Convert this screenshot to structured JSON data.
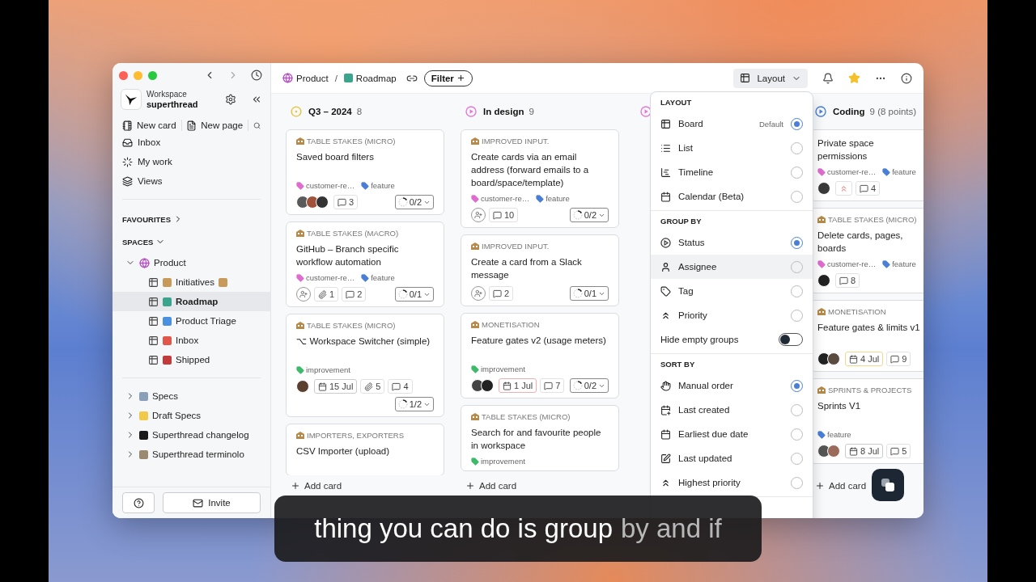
{
  "sidebar": {
    "workspace": {
      "caption": "Workspace",
      "name": "superthread"
    },
    "actions": [
      {
        "label": "New card"
      },
      {
        "label": "New page"
      }
    ],
    "nav": [
      {
        "label": "Inbox"
      },
      {
        "label": "My work"
      },
      {
        "label": "Views"
      }
    ],
    "favourites": {
      "label": "FAVOURITES",
      "expanded": false
    },
    "spaces": {
      "label": "SPACES",
      "expanded": true
    },
    "tree": [
      {
        "kind": "space",
        "label": "Product",
        "color": "#b44fc4",
        "expanded": true,
        "selected": false,
        "children": [
          {
            "kind": "board",
            "label": "Initiatives",
            "color": "#c89a5a",
            "icon_after": true,
            "selected": false
          },
          {
            "kind": "board",
            "label": "Roadmap",
            "color": "#3aa58c",
            "selected": true
          },
          {
            "kind": "board",
            "label": "Product Triage",
            "color": "#4a8fe0",
            "selected": false
          },
          {
            "kind": "board",
            "label": "Inbox",
            "color": "#e0564a",
            "selected": false
          },
          {
            "kind": "board",
            "label": "Shipped",
            "color": "#c23a3a",
            "selected": false
          }
        ]
      },
      {
        "kind": "page",
        "label": "Specs",
        "color": "#8aa0b8",
        "expanded": false,
        "selected": false
      },
      {
        "kind": "page",
        "label": "Draft Specs",
        "color": "#f0c94a",
        "expanded": false,
        "selected": false
      },
      {
        "kind": "page",
        "label": "Superthread changelog",
        "color": "#1a1a1a",
        "expanded": false,
        "selected": false
      },
      {
        "kind": "page",
        "label": "Superthread terminolo",
        "color": "#9a8a70",
        "expanded": false,
        "selected": false
      }
    ],
    "invite": "Invite"
  },
  "topbar": {
    "breadcrumb": [
      {
        "label": "Product",
        "color": "#b44fc4"
      },
      {
        "label": "Roadmap",
        "color": "#3aa58c"
      }
    ],
    "separator": "/",
    "filter": "Filter",
    "layout": "Layout",
    "starred": true
  },
  "columns": [
    {
      "kind": "planned",
      "title": "Q3 – 2024",
      "count": "8",
      "color": "#e8c33a",
      "add": "Add card",
      "cards": [
        {
          "label": "TABLE STAKES (MICRO)",
          "title": "Saved board filters",
          "tags": [
            {
              "label": "customer-re…",
              "color": "#e06ccf"
            },
            {
              "label": "feature",
              "color": "#4a7fd8"
            }
          ],
          "avatars": [
            {
              "color": "#5a5a5a"
            },
            {
              "color": "#a0523a"
            },
            {
              "color": "#333333"
            }
          ],
          "chips": [
            {
              "kind": "comment",
              "text": "3"
            }
          ],
          "progress": {
            "text": "0/2"
          }
        },
        {
          "label": "TABLE STAKES (MACRO)",
          "title": "GitHub – Branch specific workflow automation",
          "tags": [
            {
              "label": "customer-re…",
              "color": "#e06ccf"
            },
            {
              "label": "feature",
              "color": "#4a7fd8"
            }
          ],
          "assign": true,
          "chips": [
            {
              "kind": "attachment",
              "text": "1"
            },
            {
              "kind": "comment",
              "text": "2"
            }
          ],
          "progress": {
            "text": "0/1"
          }
        },
        {
          "label": "TABLE STAKES (MICRO)",
          "title": "⌥ Workspace Switcher (simple)",
          "tags": [
            {
              "label": "improvement",
              "color": "#3dbb6a"
            }
          ],
          "avatars": [
            {
              "color": "#5b4030"
            }
          ],
          "chips": [
            {
              "kind": "date",
              "text": "15 Jul",
              "color": "#c8ccd1"
            },
            {
              "kind": "attachment",
              "text": "5"
            },
            {
              "kind": "comment",
              "text": "4"
            }
          ],
          "progress": {
            "text": "1/2"
          }
        },
        {
          "label": "IMPORTERS, EXPORTERS",
          "title": "CSV Importer (upload)"
        }
      ]
    },
    {
      "kind": "started",
      "title": "In design",
      "count": "9",
      "color": "#e27ad8",
      "add": "Add card",
      "cards": [
        {
          "label": "IMPROVED INPUT.",
          "title": "Create cards via an email address (forward emails to a board/space/template)",
          "tags": [
            {
              "label": "customer-re…",
              "color": "#e06ccf"
            },
            {
              "label": "feature",
              "color": "#4a7fd8"
            }
          ],
          "assign": true,
          "chips": [
            {
              "kind": "comment",
              "text": "10"
            }
          ],
          "progress": {
            "text": "0/2"
          }
        },
        {
          "label": "IMPROVED INPUT.",
          "title": "Create a card from a Slack message",
          "assign": true,
          "chips": [
            {
              "kind": "comment",
              "text": "2"
            }
          ],
          "progress": {
            "text": "0/1"
          }
        },
        {
          "label": "MONETISATION",
          "title": "Feature gates v2 (usage meters)",
          "tags": [
            {
              "label": "improvement",
              "color": "#3dbb6a"
            }
          ],
          "avatars": [
            {
              "color": "#444444"
            },
            {
              "color": "#222222"
            }
          ],
          "chips": [
            {
              "kind": "date",
              "text": "1 Jul",
              "color": "#f0b0b0"
            },
            {
              "kind": "comment",
              "text": "7"
            }
          ],
          "progress": {
            "text": "0/2"
          }
        },
        {
          "label": "TABLE STAKES (MICRO)",
          "title": "Search for and favourite people in workspace",
          "tags": [
            {
              "label": "improvement",
              "color": "#3dbb6a"
            }
          ]
        }
      ]
    },
    {
      "kind": "started",
      "color": "#e27ad8"
    },
    {
      "kind": "started",
      "title": "Coding",
      "count": "9 (8 points)",
      "color": "#4a7fd8",
      "add": "Add card",
      "cards": [
        {
          "title": "Private space permissions",
          "tags": [
            {
              "label": "customer-re…",
              "color": "#e06ccf"
            },
            {
              "label": "feature",
              "color": "#4a7fd8"
            }
          ],
          "avatars": [
            {
              "color": "#3a3a3a"
            }
          ],
          "chips": [
            {
              "kind": "priority"
            },
            {
              "kind": "comment",
              "text": "4"
            }
          ]
        },
        {
          "label": "TABLE STAKES (MICRO)",
          "title": "Delete cards, pages, boards",
          "tags": [
            {
              "label": "customer-re…",
              "color": "#e06ccf"
            },
            {
              "label": "feature",
              "color": "#4a7fd8"
            }
          ],
          "avatars": [
            {
              "color": "#222222"
            }
          ],
          "chips": [
            {
              "kind": "comment",
              "text": "8"
            }
          ]
        },
        {
          "label": "MONETISATION",
          "title": "Feature gates & limits v1",
          "avatars": [
            {
              "color": "#222222"
            },
            {
              "color": "#5a4a40"
            }
          ],
          "chips": [
            {
              "kind": "date",
              "text": "4 Jul",
              "color": "#f0d890"
            },
            {
              "kind": "comment",
              "text": "9"
            }
          ]
        },
        {
          "label": "SPRINTS & PROJECTS",
          "title": "Sprints V1",
          "tags": [
            {
              "label": "feature",
              "color": "#4a7fd8"
            }
          ],
          "avatars": [
            {
              "color": "#555555"
            },
            {
              "color": "#9a6a5a"
            }
          ],
          "chips": [
            {
              "kind": "date",
              "text": "8 Jul",
              "color": "#c8ccd1"
            },
            {
              "kind": "comment",
              "text": "5"
            }
          ]
        }
      ]
    }
  ],
  "menu": {
    "sections": [
      {
        "title": "LAYOUT",
        "items": [
          {
            "kind": "option",
            "label": "Board",
            "note": "Default",
            "selected": true,
            "hovered": false
          },
          {
            "kind": "option",
            "label": "List",
            "selected": false,
            "hovered": false
          },
          {
            "kind": "option",
            "label": "Timeline",
            "selected": false,
            "hovered": false
          },
          {
            "kind": "option",
            "label": "Calendar (Beta)",
            "selected": false,
            "hovered": false
          }
        ]
      },
      {
        "title": "GROUP BY",
        "items": [
          {
            "kind": "option",
            "label": "Status",
            "selected": true,
            "hovered": false
          },
          {
            "kind": "option",
            "label": "Assignee",
            "selected": false,
            "hovered": true
          },
          {
            "kind": "option",
            "label": "Tag",
            "selected": false,
            "hovered": false
          },
          {
            "kind": "option",
            "label": "Priority",
            "selected": false,
            "hovered": false
          },
          {
            "kind": "toggle",
            "label": "Hide empty groups",
            "on": false
          }
        ]
      },
      {
        "title": "SORT BY",
        "items": [
          {
            "kind": "option",
            "label": "Manual order",
            "selected": true,
            "hovered": false
          },
          {
            "kind": "option",
            "label": "Last created",
            "selected": false,
            "hovered": false
          },
          {
            "kind": "option",
            "label": "Earliest due date",
            "selected": false,
            "hovered": false
          },
          {
            "kind": "option",
            "label": "Last updated",
            "selected": false,
            "hovered": false
          },
          {
            "kind": "option",
            "label": "Highest priority",
            "selected": false,
            "hovered": false
          }
        ]
      }
    ]
  },
  "caption": {
    "spoken": "thing you can do is group",
    "upcoming": "by and if"
  }
}
